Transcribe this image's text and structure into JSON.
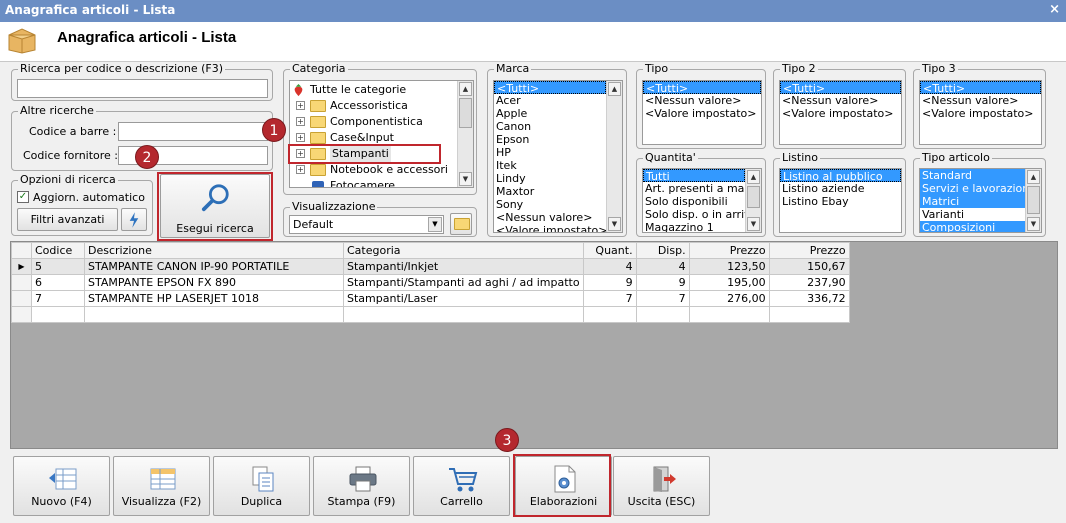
{
  "window": {
    "title": "Anagrafica articoli  - Lista",
    "close_glyph": "×"
  },
  "header": {
    "title": "Anagrafica articoli  - Lista",
    "icon": "box-icon"
  },
  "search": {
    "legend": "Ricerca per codice o descrizione (F3)",
    "value": ""
  },
  "other_search": {
    "legend": "Altre ricerche",
    "barcode_label": "Codice a barre :",
    "barcode_value": "",
    "supplier_label": "Codice fornitore :",
    "supplier_value": ""
  },
  "options": {
    "legend": "Opzioni di ricerca",
    "auto_update_label": "Aggiorn. automatico",
    "auto_update_checked": true,
    "advanced_filters_label": "Filtri avanzati"
  },
  "search_button": {
    "label": "Esegui ricerca"
  },
  "category": {
    "legend": "Categoria",
    "root": "Tutte le categorie",
    "items": [
      "Accessoristica",
      "Componentistica",
      "Case&Input",
      "Stampanti",
      "Notebook e accessori",
      "Fotocamere"
    ],
    "selected": "Stampanti"
  },
  "view": {
    "legend": "Visualizzazione",
    "value": "Default"
  },
  "brand": {
    "legend": "Marca",
    "items": [
      "<Tutti>",
      "Acer",
      "Apple",
      "Canon",
      "Epson",
      "HP",
      "Itek",
      "Lindy",
      "Maxtor",
      "Sony",
      "<Nessun valore>",
      "<Valore impostato>"
    ]
  },
  "tipo": {
    "legend": "Tipo",
    "items": [
      "<Tutti>",
      "<Nessun valore>",
      "<Valore impostato>"
    ]
  },
  "tipo2": {
    "legend": "Tipo 2",
    "items": [
      "<Tutti>",
      "<Nessun valore>",
      "<Valore impostato>"
    ]
  },
  "tipo3": {
    "legend": "Tipo 3",
    "items": [
      "<Tutti>",
      "<Nessun valore>",
      "<Valore impostato>"
    ]
  },
  "quantita": {
    "legend": "Quantita'",
    "items": [
      "Tutti",
      "Art. presenti a magazzino",
      "Solo disponibili",
      "Solo disp. o in arrivo",
      "Magazzino 1"
    ]
  },
  "listino": {
    "legend": "Listino",
    "items": [
      "Listino al pubblico",
      "Listino aziende",
      "Listino Ebay"
    ]
  },
  "tipo_articolo": {
    "legend": "Tipo articolo",
    "items": [
      "Standard",
      "Servizi e lavorazioni",
      "Matrici",
      "Varianti",
      "Composizioni"
    ]
  },
  "grid": {
    "columns": [
      "Codice",
      "Descrizione",
      "Categoria",
      "Quant.",
      "Disp.",
      "Prezzo",
      "Prezzo"
    ],
    "rows": [
      [
        "5",
        "STAMPANTE CANON IP-90 PORTATILE",
        "Stampanti/Inkjet",
        "4",
        "4",
        "123,50",
        "150,67"
      ],
      [
        "6",
        "STAMPANTE EPSON FX 890",
        "Stampanti/Stampanti ad aghi / ad impatto",
        "9",
        "9",
        "195,00",
        "237,90"
      ],
      [
        "7",
        "STAMPANTE HP LASERJET 1018",
        "Stampanti/Laser",
        "7",
        "7",
        "276,00",
        "336,72"
      ]
    ],
    "row_indicator": "▶"
  },
  "toolbar": {
    "nuovo": "Nuovo (F4)",
    "visualizza": "Visualizza (F2)",
    "duplica": "Duplica",
    "stampa": "Stampa (F9)",
    "carrello": "Carrello",
    "elaborazioni": "Elaborazioni",
    "uscita": "Uscita (ESC)"
  },
  "badges": [
    "1",
    "2",
    "3"
  ],
  "colors": {
    "accent": "#3399ff",
    "titlebar": "#6b8ec4",
    "highlight": "#c0262d"
  }
}
